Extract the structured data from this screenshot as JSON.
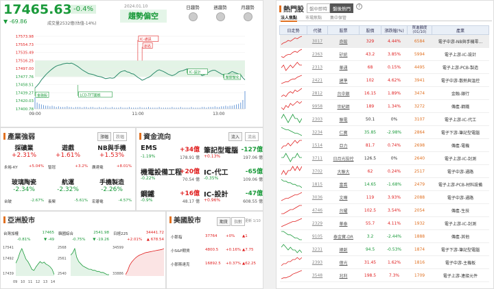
{
  "index": {
    "price": "17465.63",
    "pct": "-0.4%",
    "change": "▼ -69.86",
    "date": "2024.01.10",
    "volume": "成交量2532億(估值-14%)",
    "trend_label": "趨勢偏空"
  },
  "trend_lights": [
    {
      "label": "日趨勢"
    },
    {
      "label": "週趨勢"
    },
    {
      "label": "月趨勢"
    }
  ],
  "chart_data": {
    "type": "line",
    "y_ticks": [
      "17573.98",
      "17554.73",
      "17535.49",
      "17516.25",
      "17497.00",
      "17477.76",
      "17458.51",
      "17439.27",
      "17420.03",
      "17400.78"
    ],
    "x_ticks": [
      "09:00",
      "11:00",
      "13:00"
    ],
    "ylim": [
      17400.78,
      17573.98
    ],
    "annotations": [
      "IC-通訊",
      "創名",
      "IC-設計",
      "LCD-TFT面板",
      "金融股",
      "塑膠塑化"
    ],
    "line": [
      17451,
      17456,
      17462,
      17470,
      17476,
      17482,
      17487,
      17492,
      17496,
      17500,
      17503,
      17505,
      17506,
      17508,
      17509,
      17510,
      17509,
      17510,
      17508,
      17505,
      17502,
      17498,
      17494,
      17491,
      17488,
      17485,
      17484,
      17483,
      17481,
      17479,
      17478,
      17477,
      17475,
      17473,
      17474,
      17475,
      17474,
      17475,
      17480,
      17485,
      17489,
      17491,
      17492,
      17489,
      17488,
      17485,
      17484,
      17480,
      17476,
      17473,
      17469,
      17471,
      17474,
      17476,
      17479,
      17484,
      17488,
      17492,
      17494,
      17492,
      17490,
      17487,
      17484,
      17482,
      17480,
      17482,
      17485,
      17489,
      17491,
      17492,
      17494,
      17496,
      17495,
      17493,
      17492,
      17488,
      17486,
      17485,
      17480,
      17482,
      17485,
      17488,
      17491,
      17493,
      17493,
      17490,
      17487,
      17484,
      17482,
      17481,
      17484,
      17487,
      17490,
      17488,
      17486,
      17484,
      17482,
      17475,
      17470
    ],
    "volume": [
      18,
      10,
      8,
      7,
      6,
      5,
      5,
      4,
      5,
      4,
      3,
      4,
      3,
      3,
      3,
      4,
      3,
      3,
      2,
      3,
      3,
      3,
      2,
      3,
      3,
      2,
      3,
      3,
      2,
      2,
      3,
      2,
      2,
      3,
      2,
      2,
      3,
      2,
      2,
      2,
      3,
      2,
      2,
      2,
      3,
      2,
      2,
      2,
      2,
      3,
      2,
      2,
      2,
      3,
      2,
      2,
      2,
      2,
      3,
      2,
      2,
      2,
      2,
      2,
      3,
      2,
      2,
      2,
      3,
      2,
      2,
      2,
      2,
      3,
      2,
      2,
      2,
      2,
      3,
      3,
      2,
      3,
      3,
      3,
      4,
      3,
      3,
      4,
      4,
      5,
      4,
      5,
      5,
      6,
      7,
      8,
      10,
      14,
      28
    ]
  },
  "industry": {
    "title": "產業強弱",
    "tab_rise": "漲幅",
    "tab_fall": "跌幅",
    "cells": [
      {
        "name": "採礦業",
        "pct": "+2.31%",
        "sub_name": "永裕-KY",
        "sub_pct": "+5.04%",
        "dir": "up"
      },
      {
        "name": "遊戲",
        "pct": "+1.61%",
        "sub_name": "智冠",
        "sub_pct": "+3.2%",
        "dir": "up"
      },
      {
        "name": "NB與手機",
        "pct": "+1.53%",
        "sub_name": "廣達電",
        "sub_pct": "+8.01%",
        "dir": "up"
      },
      {
        "name": "玻璃陶瓷",
        "pct": "-2.34%",
        "sub_name": "台玻",
        "sub_pct": "-2.67%",
        "dir": "down"
      },
      {
        "name": "航運",
        "pct": "-2.32%",
        "sub_name": "長榮",
        "sub_pct": "-5.61%",
        "dir": "down"
      },
      {
        "name": "手機製造",
        "pct": "-2.26%",
        "sub_name": "宏碁電",
        "sub_pct": "-4.57%",
        "dir": "down"
      }
    ]
  },
  "capital": {
    "title": "資金流向",
    "tab_in": "流入",
    "tab_out": "流出",
    "cells": [
      {
        "name": "EMS",
        "value": "+34億",
        "pct": "-1.19%",
        "amount": "178.91 億",
        "vdir": "up",
        "pdir": "down"
      },
      {
        "name": "筆記型電腦",
        "value": "-127億",
        "pct": "+0.13%",
        "amount": "197.06 億",
        "vdir": "down",
        "pdir": "up"
      },
      {
        "name": "機電設備工程",
        "value": "+20億",
        "pct": "-0.22%",
        "amount": "70.54 億",
        "vdir": "up",
        "pdir": "down"
      },
      {
        "name": "IC-代工",
        "value": "-65億",
        "pct": "-0.35%",
        "amount": "109.06 億",
        "vdir": "down",
        "pdir": "down"
      },
      {
        "name": "鋼鐵",
        "value": "+16億",
        "pct": "-0.9%",
        "amount": "48.17 億",
        "vdir": "up",
        "pdir": "down"
      },
      {
        "name": "IC-設計",
        "value": "-47億",
        "pct": "+0.96%",
        "amount": "608.55 億",
        "vdir": "down",
        "pdir": "up"
      }
    ]
  },
  "asia": {
    "title": "亞洲股市",
    "cards": [
      {
        "name": "台灣加權",
        "price": "17465",
        "pct": "-0.81%",
        "chg": "▼ -49",
        "ytop": "17541",
        "ymid": "17492",
        "ybot": "17439",
        "xlabels": "09 10 11 12 13 14",
        "dir": "down",
        "line": [
          17492,
          17500,
          17512,
          17520,
          17510,
          17500,
          17495,
          17488,
          17480,
          17478,
          17485,
          17490,
          17495,
          17492,
          17494,
          17490,
          17488,
          17485,
          17480,
          17470
        ]
      },
      {
        "name": "韓國綜合",
        "price": "2541.98",
        "pct": "-0.75%",
        "chg": "▼ -19.26",
        "ytop": "2568",
        "ymid": "2561",
        "ybot": "2540",
        "xlabels": "",
        "dir": "down",
        "line": [
          2560,
          2562,
          2566,
          2558,
          2554,
          2552,
          2550,
          2549,
          2548,
          2547,
          2547,
          2546,
          2546,
          2545,
          2545,
          2544,
          2544,
          2543,
          2542,
          2542
        ]
      },
      {
        "name": "日經225",
        "price": "34441.72",
        "pct": "+2.01%",
        "chg": "▲ 678.54",
        "ytop": "34599",
        "ymid": "",
        "ybot": "33886",
        "xlabels": "",
        "dir": "up",
        "line": [
          33890,
          33980,
          34120,
          34200,
          34260,
          34310,
          34350,
          34380,
          34400,
          34420,
          34440,
          34450,
          34460,
          34470,
          34480,
          34490,
          34500,
          34510,
          34520,
          34540
        ]
      }
    ]
  },
  "america": {
    "title": "美國股市",
    "tab_a": "期貨",
    "tab_b": "指數",
    "page": "更新 1/10",
    "rows": [
      {
        "name": "小那指",
        "price": "37764",
        "pct": "+0%",
        "chg": "▲1",
        "dir": "up"
      },
      {
        "name": "小S&P期貨",
        "price": "4800.5",
        "pct": "+0.16%",
        "chg": "▲7.75",
        "dir": "up"
      },
      {
        "name": "小那斯達克",
        "price": "16892.5",
        "pct": "+0.37%",
        "chg": "▲62.25",
        "dir": "up"
      }
    ]
  },
  "hot": {
    "title": "熱門股",
    "tab1": "盤中即時",
    "tab2": "盤後熱門",
    "subtabs": [
      "法人焦點",
      "市場焦點",
      "集中保管"
    ],
    "headers": [
      "日走勢",
      "代號",
      "股票",
      "股價",
      "漲跌幅(%)",
      "買進額度\n(01/10)",
      "產業"
    ],
    "rows": [
      {
        "code": "3017",
        "name": "奇鋐",
        "price": "329",
        "pct": "4.44%",
        "amount": "6584",
        "industry": "電子中游-NB與手機零...",
        "dir": "up",
        "trend": [
          0,
          2,
          3,
          5,
          4,
          6,
          8,
          7,
          9,
          10
        ]
      },
      {
        "code": "2363",
        "name": "矽統",
        "price": "43.2",
        "pct": "3.85%",
        "amount": "5994",
        "industry": "電子上游-IC-設計",
        "dir": "up",
        "trend": [
          2,
          1,
          3,
          4,
          4,
          6,
          7,
          6,
          8,
          9
        ]
      },
      {
        "code": "2313",
        "name": "華通",
        "price": "68",
        "pct": "0.15%",
        "amount": "4495",
        "industry": "電子上游-PCB-製造",
        "dir": "up",
        "trend": [
          5,
          6,
          4,
          5,
          6,
          5,
          6,
          7,
          6,
          6
        ]
      },
      {
        "code": "2421",
        "name": "建準",
        "price": "102",
        "pct": "4.62%",
        "amount": "3941",
        "industry": "電子中游-散熱與溫控",
        "dir": "up",
        "trend": [
          1,
          2,
          3,
          3,
          5,
          6,
          6,
          8,
          9,
          10
        ]
      },
      {
        "code": "2812",
        "name": "台中銀",
        "price": "16.15",
        "pct": "1.89%",
        "amount": "3474",
        "industry": "金融-銀行",
        "dir": "up",
        "trend": [
          3,
          4,
          3,
          5,
          6,
          5,
          7,
          6,
          7,
          8
        ]
      },
      {
        "code": "9958",
        "name": "世紀鋼",
        "price": "189",
        "pct": "1.34%",
        "amount": "3272",
        "industry": "傳產-鋼鐵",
        "dir": "up",
        "trend": [
          4,
          3,
          5,
          4,
          6,
          5,
          6,
          7,
          6,
          7
        ]
      },
      {
        "code": "2303",
        "name": "聯電",
        "price": "50.1",
        "pct": "0%",
        "amount": "3107",
        "industry": "電子上游-IC-代工",
        "dir": "flat",
        "trend": [
          5,
          6,
          5,
          4,
          5,
          6,
          5,
          5,
          4,
          5
        ]
      },
      {
        "code": "3234",
        "name": "仁寶",
        "price": "35.85",
        "pct": "-2.98%",
        "amount": "2864",
        "industry": "電子下游-筆記型電腦",
        "dir": "down",
        "trend": [
          9,
          8,
          7,
          7,
          6,
          5,
          4,
          4,
          3,
          2
        ]
      },
      {
        "code": "1514",
        "name": "亞力",
        "price": "81.7",
        "pct": "0.74%",
        "amount": "2698",
        "industry": "傳產-電機",
        "dir": "up",
        "trend": [
          3,
          4,
          4,
          5,
          4,
          5,
          6,
          5,
          6,
          6
        ]
      },
      {
        "code": "3711",
        "name": "日月光投控",
        "price": "126.5",
        "pct": "0%",
        "amount": "2640",
        "industry": "電子上游-IC-封測",
        "dir": "flat",
        "trend": [
          5,
          5,
          6,
          5,
          4,
          5,
          5,
          6,
          5,
          5
        ]
      },
      {
        "code": "3702",
        "name": "大聯大",
        "price": "62",
        "pct": "0.24%",
        "amount": "2517",
        "industry": "電子中游-通路",
        "dir": "up",
        "trend": [
          4,
          5,
          4,
          5,
          5,
          6,
          5,
          6,
          5,
          6
        ]
      },
      {
        "code": "1815",
        "name": "富喬",
        "price": "14.65",
        "pct": "-1.68%",
        "amount": "2479",
        "industry": "電子上游-PCB-材料設備",
        "dir": "down",
        "trend": [
          8,
          7,
          7,
          6,
          6,
          5,
          5,
          4,
          4,
          3
        ]
      },
      {
        "code": "3036",
        "name": "文曄",
        "price": "119",
        "pct": "3.93%",
        "amount": "2088",
        "industry": "電子中游-通路",
        "dir": "up",
        "trend": [
          2,
          3,
          4,
          4,
          5,
          6,
          7,
          7,
          8,
          9
        ]
      },
      {
        "code": "4746",
        "name": "台耀",
        "price": "102.5",
        "pct": "3.54%",
        "amount": "2054",
        "industry": "傳產-生技",
        "dir": "up",
        "trend": [
          2,
          2,
          3,
          4,
          5,
          5,
          6,
          7,
          8,
          8
        ]
      },
      {
        "code": "2329",
        "name": "華泰",
        "price": "55.7",
        "pct": "4.11%",
        "amount": "1932",
        "industry": "電子上游-IC-封測",
        "dir": "up",
        "trend": [
          1,
          2,
          3,
          4,
          5,
          6,
          6,
          7,
          8,
          9
        ]
      },
      {
        "code": "9105",
        "name": "泰金寶-DR",
        "price": "3.2",
        "pct": "-2.44%",
        "amount": "1888",
        "industry": "傳產-其他",
        "dir": "down",
        "trend": [
          8,
          8,
          7,
          6,
          6,
          5,
          4,
          4,
          3,
          3
        ]
      },
      {
        "code": "3231",
        "name": "緯創",
        "price": "94.5",
        "pct": "-0.53%",
        "amount": "1874",
        "industry": "電子下游-筆記型電腦",
        "dir": "down",
        "trend": [
          6,
          7,
          6,
          5,
          6,
          5,
          5,
          4,
          5,
          4
        ]
      },
      {
        "code": "2393",
        "name": "億光",
        "price": "31.45",
        "pct": "1.62%",
        "amount": "1816",
        "industry": "電子中游-主機板",
        "dir": "up",
        "trend": [
          3,
          4,
          4,
          5,
          5,
          6,
          6,
          7,
          6,
          7
        ]
      },
      {
        "code": "3548",
        "name": "兆利",
        "price": "198.5",
        "pct": "7.3%",
        "amount": "1709",
        "industry": "電子上游-連接元件",
        "dir": "up",
        "trend": [
          1,
          2,
          2,
          3,
          4,
          6,
          7,
          8,
          9,
          10
        ]
      }
    ]
  },
  "colors": {
    "up": "#e02020",
    "down": "#1a9a3a",
    "line": "#2a8a6a",
    "accent": "#e07020"
  }
}
